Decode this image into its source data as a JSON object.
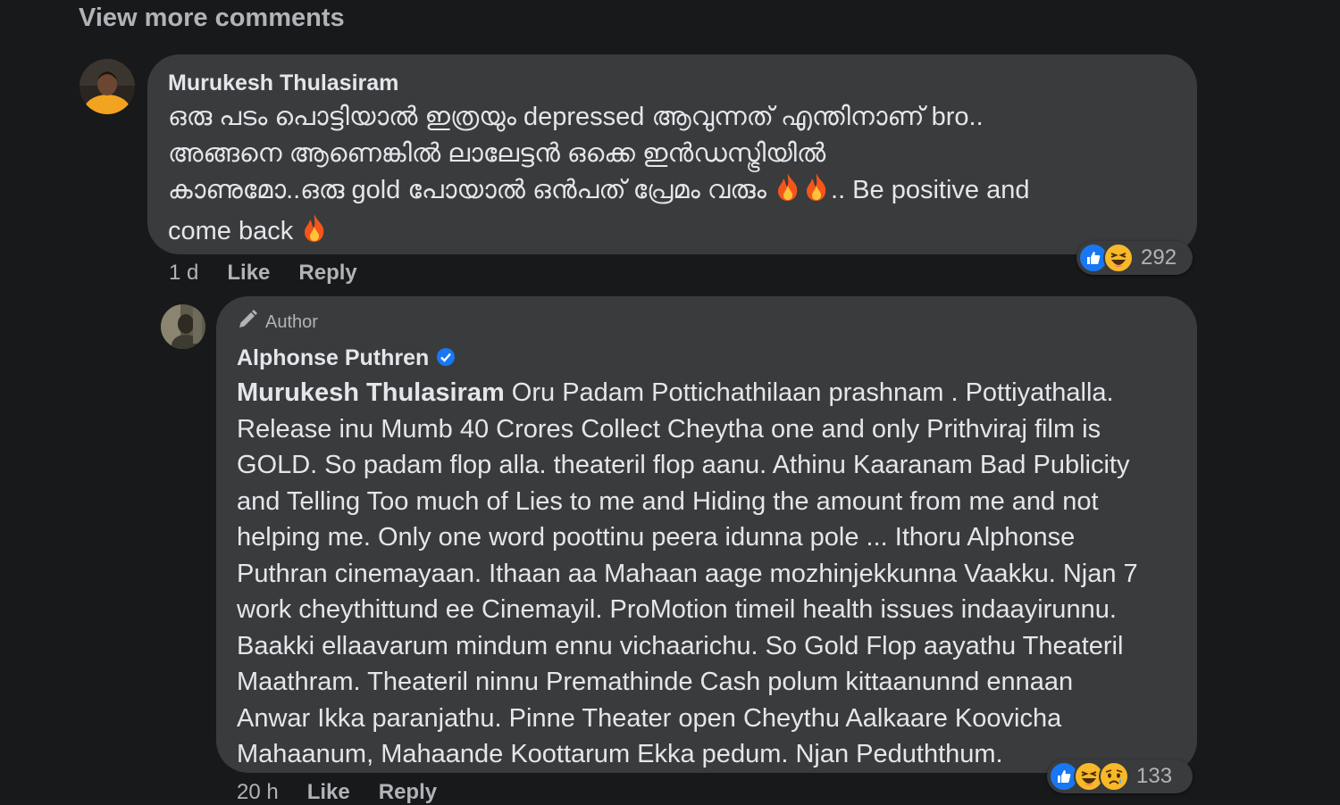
{
  "thread": {
    "view_more": "View more comments"
  },
  "comment1": {
    "author": "Murukesh Thulasiram",
    "line1": "ഒരു പടം പൊട്ടിയാൽ ഇത്രയും depressed ആവുന്നത് എന്തിനാണ് bro..",
    "line2": "അങ്ങനെ ആണെങ്കിൽ ലാലേട്ടൻ ഒക്കെ ഇൻഡസ്ട്രിയിൽ",
    "line3_a": "കാണുമോ..ഒരു gold പോയാൽ ഒൻപത് പ്രേമം വരും",
    "line3_b": ".. Be positive and",
    "line4": "come back",
    "time": "1 d",
    "like_label": "Like",
    "reply_label": "Reply",
    "reaction_count": "292",
    "reactions": [
      "like-icon",
      "haha-icon"
    ]
  },
  "reply1": {
    "badge": "Author",
    "author": "Alphonse Puthren",
    "mention": "Murukesh Thulasiram",
    "lines": [
      " Oru Padam Pottichathilaan prashnam . Pottiyathalla.",
      "Release inu Mumb 40 Crores Collect Cheytha one and only Prithviraj film is",
      "GOLD. So padam flop alla. theateril flop aanu. Athinu Kaaranam Bad Publicity",
      "and Telling Too much of Lies to me and Hiding the amount from me and not",
      "helping me. Only one word poottinu peera idunna pole ... Ithoru Alphonse",
      "Puthran cinemayaan. Ithaan aa Mahaan aage mozhinjekkunna Vaakku. Njan 7",
      "work cheythittund ee Cinemayil. ProMotion timeil health issues indaayirunnu.",
      "Baakki ellaavarum mindum ennu vichaarichu. So Gold Flop aayathu Theateril",
      "Maathram. Theateril ninnu Premathinde Cash polum kittaanunnd ennaan",
      "Anwar Ikka paranjathu. Pinne Theater open Cheythu Aalkaare Koovicha",
      "Mahaanum, Mahaande Koottarum Ekka pedum. Njan Peduththum."
    ],
    "time": "20 h",
    "like_label": "Like",
    "reply_label": "Reply",
    "reaction_count": "133",
    "reactions": [
      "like-icon",
      "haha-icon",
      "sad-icon"
    ]
  },
  "colors": {
    "background": "#18191a",
    "bubble": "#3a3b3c",
    "text": "#e4e6eb",
    "secondary": "#b0b3b8",
    "like_blue": "#1877f2",
    "reaction_yellow": "#f7b928",
    "fire": "#f5551b"
  }
}
